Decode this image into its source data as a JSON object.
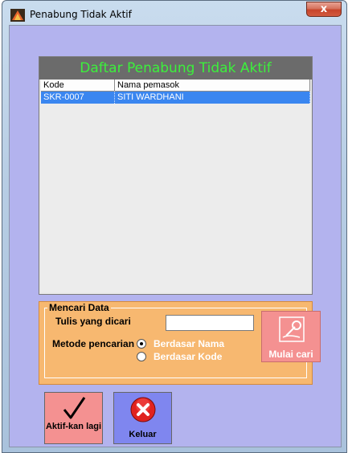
{
  "window": {
    "title": "Penabung Tidak Aktif",
    "close_label": "x"
  },
  "list": {
    "header": "Daftar Penabung Tidak Aktif",
    "columns": [
      "Kode",
      "Nama pemasok"
    ],
    "rows": [
      {
        "kode": "SKR-0007",
        "nama": "SITI WARDHANI",
        "selected": true
      }
    ]
  },
  "search": {
    "group_title": "Mencari Data",
    "query_label": "Tulis yang dicari",
    "query_value": "",
    "method_label": "Metode pencarian",
    "options": [
      {
        "label": "Berdasar Nama",
        "checked": true
      },
      {
        "label": "Berdasar Kode",
        "checked": false
      }
    ],
    "start_button": "Mulai cari"
  },
  "buttons": {
    "activate": "Aktif-kan lagi",
    "exit": "Keluar"
  },
  "colors": {
    "client_bg": "#b3b3ee",
    "header_text": "#3cf03c",
    "selection": "#3a86f0",
    "search_bg": "#f7b870",
    "pink_button": "#f49191",
    "blue_button": "#7f86ef"
  }
}
